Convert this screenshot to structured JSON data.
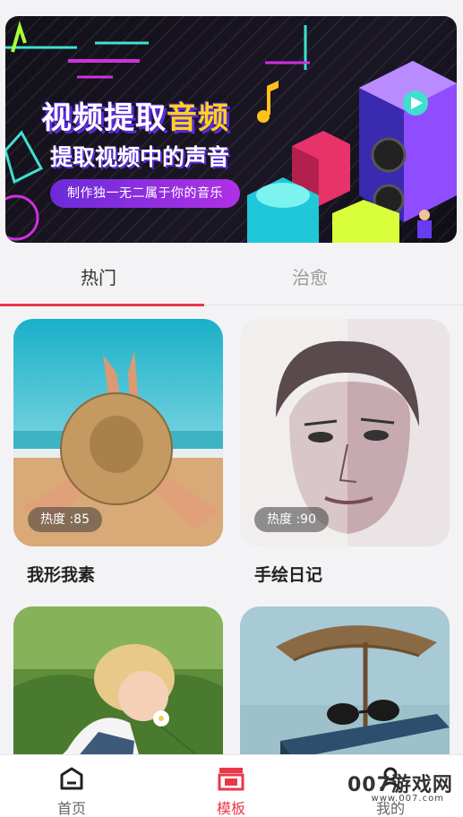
{
  "banner": {
    "title_main": "视频提取",
    "title_highlight": "音频",
    "subtitle": "提取视频中的声音",
    "pill": "制作独一无二属于你的音乐"
  },
  "tabs": [
    {
      "label": "热门",
      "active": true
    },
    {
      "label": "治愈",
      "active": false
    }
  ],
  "cards": [
    {
      "title": "我形我素",
      "badge": "热度 :85"
    },
    {
      "title": "手绘日记",
      "badge": "热度 :90"
    },
    {
      "title": "",
      "badge": ""
    },
    {
      "title": "",
      "badge": ""
    }
  ],
  "nav": [
    {
      "label": "首页",
      "icon": "home-icon",
      "active": false
    },
    {
      "label": "模板",
      "icon": "template-icon",
      "active": true
    },
    {
      "label": "我的",
      "icon": "profile-icon",
      "active": false
    }
  ],
  "watermark": {
    "text": "007游戏网",
    "url": "www.007.com"
  },
  "colors": {
    "accent": "#e8384a",
    "banner_purple": "#6b2bd9",
    "banner_yellow": "#ffd21c"
  }
}
